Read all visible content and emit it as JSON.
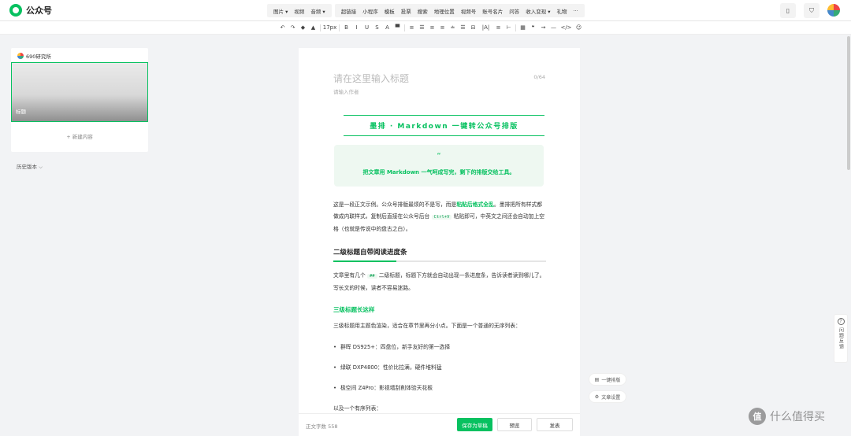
{
  "app": {
    "title": "公众号"
  },
  "menu": {
    "group1": [
      "图片",
      "视频",
      "音频"
    ],
    "group2": [
      "超链接",
      "小程序",
      "模板",
      "投票",
      "搜索",
      "地理位置",
      "视频号",
      "账号名片",
      "问答",
      "收入变现",
      "礼物",
      "···"
    ]
  },
  "toolbar": {
    "font_size": "17px",
    "tools": [
      "↶",
      "↷",
      "◆",
      "▲",
      "17px",
      "B",
      "I",
      "U",
      "S",
      "A",
      "▀",
      "≡",
      "☰",
      "≡",
      "≡",
      "≐",
      "☰",
      "⊟",
      "|A|",
      "≡",
      "⊢",
      "▦",
      "❝",
      "⇝",
      "—",
      "</>",
      "☺"
    ]
  },
  "sidebar": {
    "account_name": "690研究所",
    "thumb_label": "标题",
    "new_content": "+ 新建内容",
    "history": "历史版本 ⌵"
  },
  "editor": {
    "title_placeholder": "请在这里输入标题",
    "title_count": "0/64",
    "author_placeholder": "请输入作者",
    "banner": "墨排 · Markdown 一键转公众号排版",
    "quote_mark": "“",
    "quote_text": "把文章用 Markdown 一气呵成写完，剩下的排版交给工具。",
    "para1": {
      "a": "这是一段正文示例。公众号排版最烦的不是写，而是",
      "b": "粘贴后格式全乱",
      "c": "。墨排把所有样式都做成内联样式，复制后直接在公众号后台",
      "code": "Ctrl+V",
      "d": "粘贴即可，中英文之间还会自动加上空格（也就是传说中的盘古之白）。"
    },
    "h2": "二级标题自带阅读进度条",
    "para2": {
      "a": "文章里有几个",
      "code": "##",
      "b": "二级标题，标题下方就会自动出现一条进度条，告诉读者读到哪儿了。写长文的时候，读者不容易迷路。"
    },
    "h3": "三级标题长这样",
    "para3": "三级标题用主题色渲染，适合在章节里再分小点。下面是一个普通的无序列表：",
    "list": [
      "群晖 DS925+：四盘位，新手友好的第一选择",
      "绿联 DXP4800：性价比拉满，硬件堆料猛",
      "极空间 Z4Pro：影视墙刮削体验天花板"
    ],
    "ol_intro": "以及一个有序列表："
  },
  "footer": {
    "word_count": "正文字数  558",
    "save": "保存为草稿",
    "preview": "预览",
    "publish": "发表"
  },
  "side": {
    "one_click": "一键排版",
    "settings": "文章设置",
    "feedback": "问题反馈"
  },
  "watermark": {
    "logo": "值",
    "text": "什么值得买"
  }
}
